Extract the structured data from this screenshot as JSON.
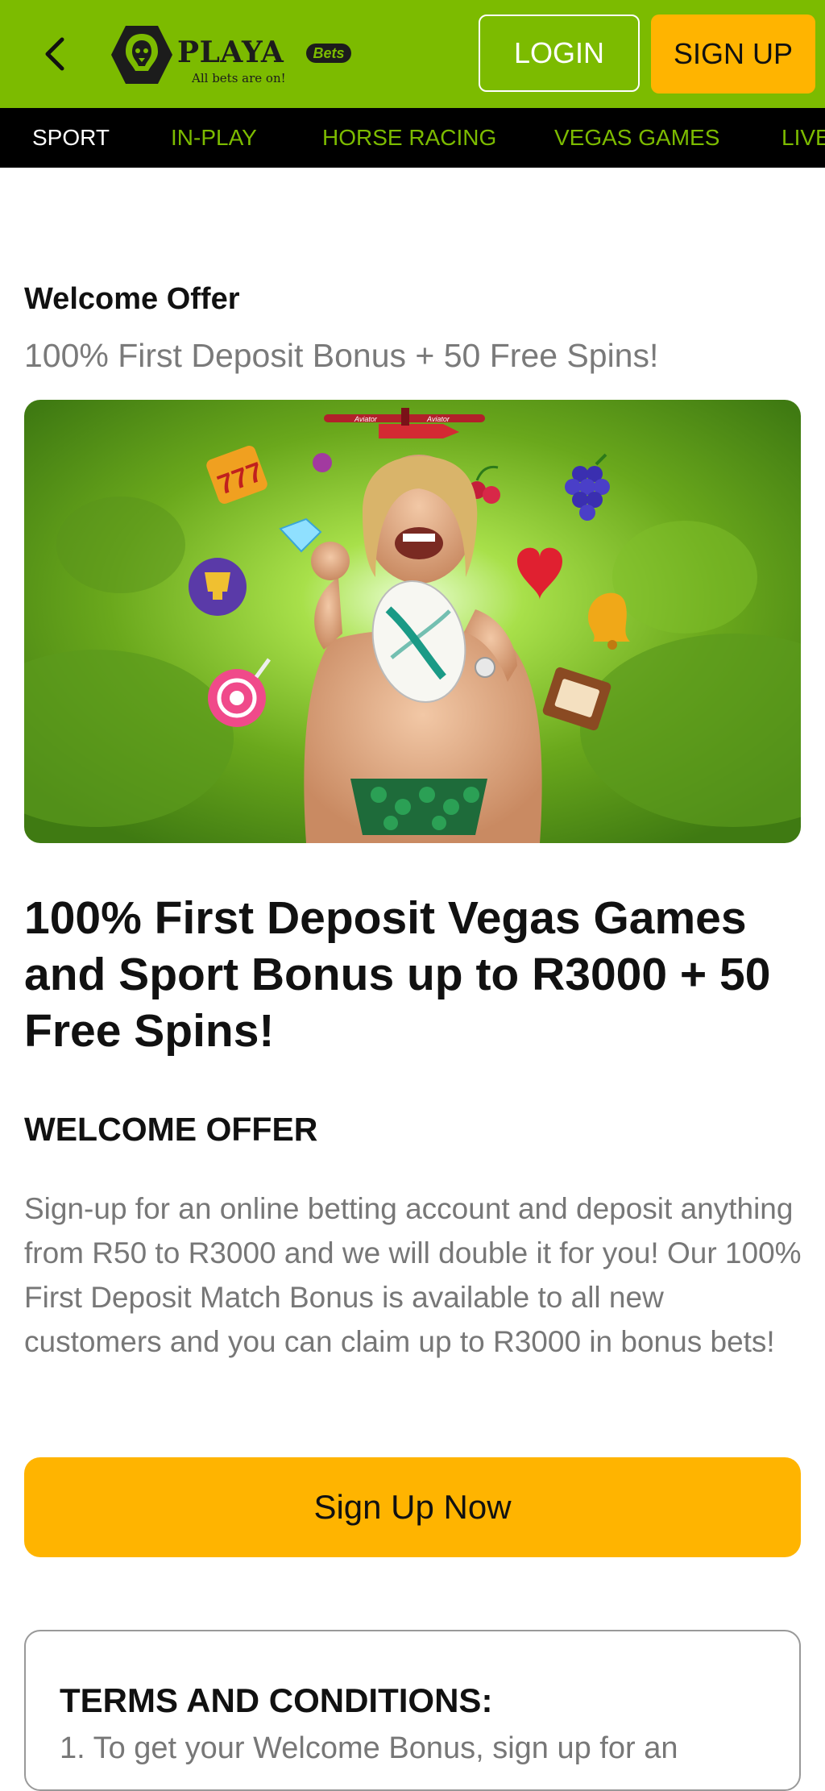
{
  "header": {
    "logo": {
      "word": "PLAYA",
      "badge": "Bets",
      "tagline": "All bets are on!"
    },
    "login_label": "LOGIN",
    "signup_label": "SIGN UP"
  },
  "nav": {
    "items": [
      {
        "label": "SPORT",
        "active": true
      },
      {
        "label": "IN-PLAY"
      },
      {
        "label": "HORSE RACING"
      },
      {
        "label": "VEGAS GAMES"
      },
      {
        "label": "LIVE"
      }
    ]
  },
  "offer": {
    "title": "Welcome Offer",
    "subtitle": "100% First Deposit Bonus + 50 Free Spins!",
    "hero_plane_text": "Aviator",
    "headline": "100% First Deposit Vegas Games and Sport Bonus up to R3000 + 50 Free Spins!",
    "section_heading": "WELCOME OFFER",
    "body": "Sign-up for an online betting account and deposit anything from R50 to R3000 and we will double it for you! Our 100% First Deposit Match Bonus is available to all new customers and you can claim up to R3000 in bonus bets!",
    "cta_label": "Sign Up Now"
  },
  "terms": {
    "title": "TERMS AND CONDITIONS:",
    "first_line": "1. To get your Welcome Bonus, sign up for an"
  },
  "colors": {
    "brand_green": "#7cbb00",
    "accent_yellow": "#ffb400",
    "nav_bg": "#000000"
  },
  "icons": {
    "back": "chevron-left-icon",
    "logo": "lion-icon"
  }
}
